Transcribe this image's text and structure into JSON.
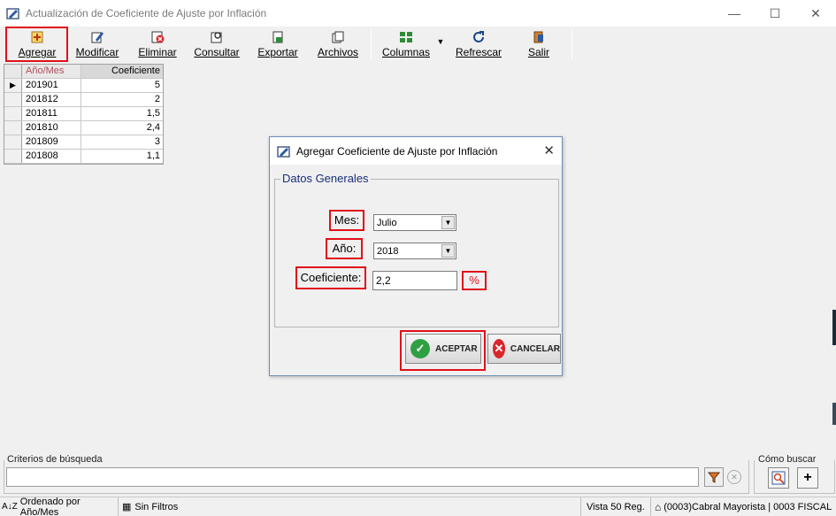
{
  "window": {
    "title": "Actualización de Coeficiente de Ajuste por Inflación",
    "minimize": "—",
    "maximize": "☐",
    "close": "✕"
  },
  "toolbar": {
    "agregar": "Agregar",
    "modificar": "Modificar",
    "eliminar": "Eliminar",
    "consultar": "Consultar",
    "exportar": "Exportar",
    "archivos": "Archivos",
    "columnas": "Columnas",
    "refrescar": "Refrescar",
    "salir": "Salir"
  },
  "grid": {
    "headers": [
      "Año/Mes",
      "Coeficiente"
    ],
    "rows": [
      [
        "201901",
        "5"
      ],
      [
        "201812",
        "2"
      ],
      [
        "201811",
        "1,5"
      ],
      [
        "201810",
        "2,4"
      ],
      [
        "201809",
        "3"
      ],
      [
        "201808",
        "1,1"
      ]
    ]
  },
  "dialog": {
    "title": "Agregar  Coeficiente de Ajuste por Inflación",
    "group_title": "Datos Generales",
    "mes_label": "Mes:",
    "mes_value": "Julio",
    "anio_label": "Año:",
    "anio_value": "2018",
    "coef_label": "Coeficiente:",
    "coef_value": "2,2",
    "pct": "%",
    "aceptar": "ACEPTAR",
    "cancelar": "CANCELAR"
  },
  "search": {
    "criterios_label": "Criterios de búsqueda",
    "como_buscar_label": "Cómo buscar",
    "add_symbol": "+"
  },
  "status": {
    "orden": "Ordenado por Año/Mes",
    "filtros": "Sin Filtros",
    "vista": "Vista 50 Reg.",
    "empresa": "(0003)Cabral Mayorista | 0003 FISCAL"
  },
  "colors": {
    "highlight": "#e0101a",
    "accent_blue": "#1a2e7a",
    "ok_green": "#2ea043",
    "cancel_red": "#d9262c"
  }
}
